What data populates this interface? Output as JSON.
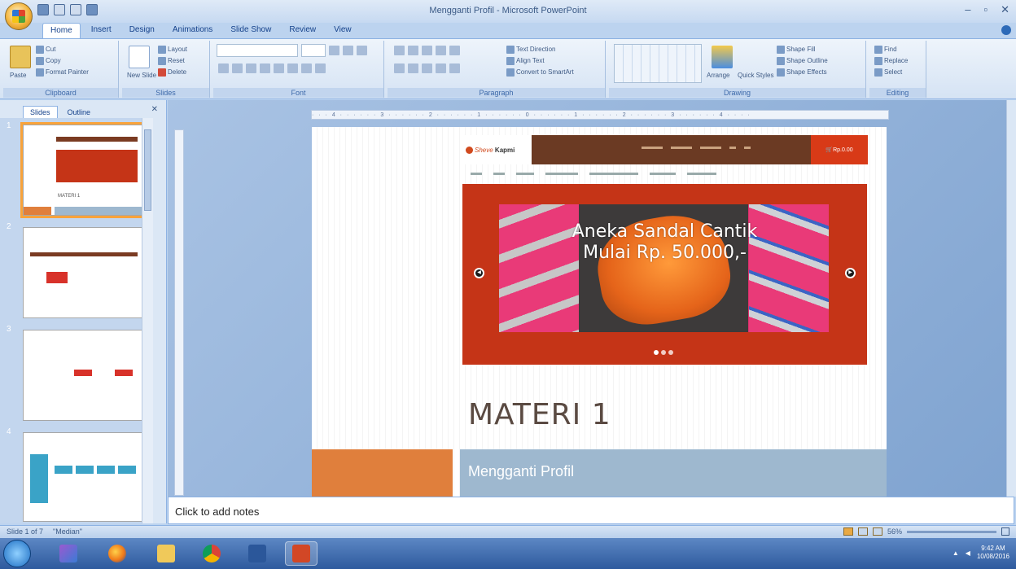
{
  "window": {
    "title": "Mengganti Profil - Microsoft PowerPoint",
    "controls": [
      "–",
      "▫",
      "✕"
    ]
  },
  "ribbon": {
    "tabs": [
      "Home",
      "Insert",
      "Design",
      "Animations",
      "Slide Show",
      "Review",
      "View"
    ],
    "active_tab": "Home",
    "groups": {
      "clipboard": {
        "label": "Clipboard",
        "paste": "Paste",
        "cut": "Cut",
        "copy": "Copy",
        "format_painter": "Format Painter"
      },
      "slides": {
        "label": "Slides",
        "new_slide": "New Slide",
        "layout": "Layout",
        "reset": "Reset",
        "delete": "Delete"
      },
      "font": {
        "label": "Font"
      },
      "paragraph": {
        "label": "Paragraph",
        "text_direction": "Text Direction",
        "align_text": "Align Text",
        "convert_smartart": "Convert to SmartArt"
      },
      "drawing": {
        "label": "Drawing",
        "arrange": "Arrange",
        "quick_styles": "Quick Styles",
        "shape_fill": "Shape Fill",
        "shape_outline": "Shape Outline",
        "shape_effects": "Shape Effects"
      },
      "editing": {
        "label": "Editing",
        "find": "Find",
        "replace": "Replace",
        "select": "Select"
      }
    }
  },
  "pane": {
    "tabs": [
      "Slides",
      "Outline"
    ],
    "active_tab": "Slides",
    "thumbnails": [
      {
        "num": "1",
        "caption": "MATERI 1",
        "selected": true
      },
      {
        "num": "2",
        "selected": false
      },
      {
        "num": "3",
        "selected": false
      },
      {
        "num": "4",
        "selected": false
      }
    ]
  },
  "slide": {
    "screenshot": {
      "logo_text": "Sheve",
      "logo_bold": "Kapmi",
      "cart_label": "Rp.0.00",
      "banner_title_line1": "Aneka Sandal Cantik",
      "banner_title_line2": "Mulai Rp. 50.000,-",
      "prev_arrow": "◀",
      "next_arrow": "▶",
      "dots_count": 3
    },
    "title": "MATERI 1",
    "subtitle": "Mengganti Profil"
  },
  "notes": {
    "placeholder": "Click to add notes"
  },
  "status": {
    "slide_info": "Slide 1 of 7",
    "theme": "\"Median\"",
    "zoom": "56%"
  },
  "taskbar": {
    "apps": [
      "start",
      "windows-media",
      "firefox",
      "file-explorer",
      "chrome",
      "word-app",
      "powerpoint"
    ],
    "active_app": "powerpoint",
    "clock_time": "9:42 AM",
    "clock_date": "10/08/2016"
  },
  "colors": {
    "ribbon_bg": "#dbe7f5",
    "slide_orange": "#e07f3c",
    "slide_blue": "#9eb8cf",
    "banner_red": "#c53417",
    "selection_outline": "#f9a33a"
  }
}
